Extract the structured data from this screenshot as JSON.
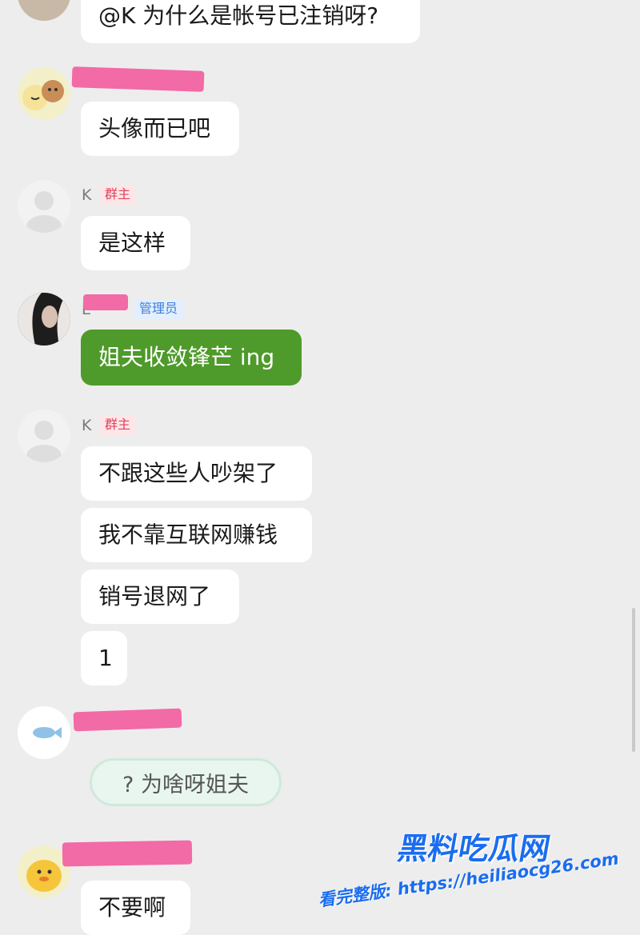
{
  "messages": [
    {
      "text": "@K 为什么是帐号已注销呀?"
    },
    {
      "text": "头像而已吧"
    },
    {
      "nickname": "K",
      "role": "群主",
      "text": "是这样"
    },
    {
      "nickname": "E",
      "role": "管理员",
      "text": "姐夫收敛锋芒 ing"
    },
    {
      "nickname": "K",
      "role": "群主",
      "texts": [
        "不跟这些人吵架了",
        "我不靠互联网赚钱",
        "销号退网了",
        "1"
      ]
    },
    {
      "sticker_text": "? 为啥呀姐夫"
    },
    {
      "text": "不要啊"
    }
  ],
  "watermark": {
    "title": "黑料吃瓜网",
    "url_line": "看完整版: https://heiliaocg26.com"
  },
  "colors": {
    "background": "#ededed",
    "bubble": "#ffffff",
    "bubble_green": "#4e9a2a",
    "owner_badge": "#e0425a",
    "admin_badge": "#3d7fd9",
    "redaction": "#f26aa6",
    "watermark": "#1a6df0"
  },
  "icons": [
    "dog-avatar-icon",
    "default-user-avatar-icon",
    "girl-avatar-icon",
    "fish-avatar-icon",
    "duck-avatar-icon"
  ]
}
